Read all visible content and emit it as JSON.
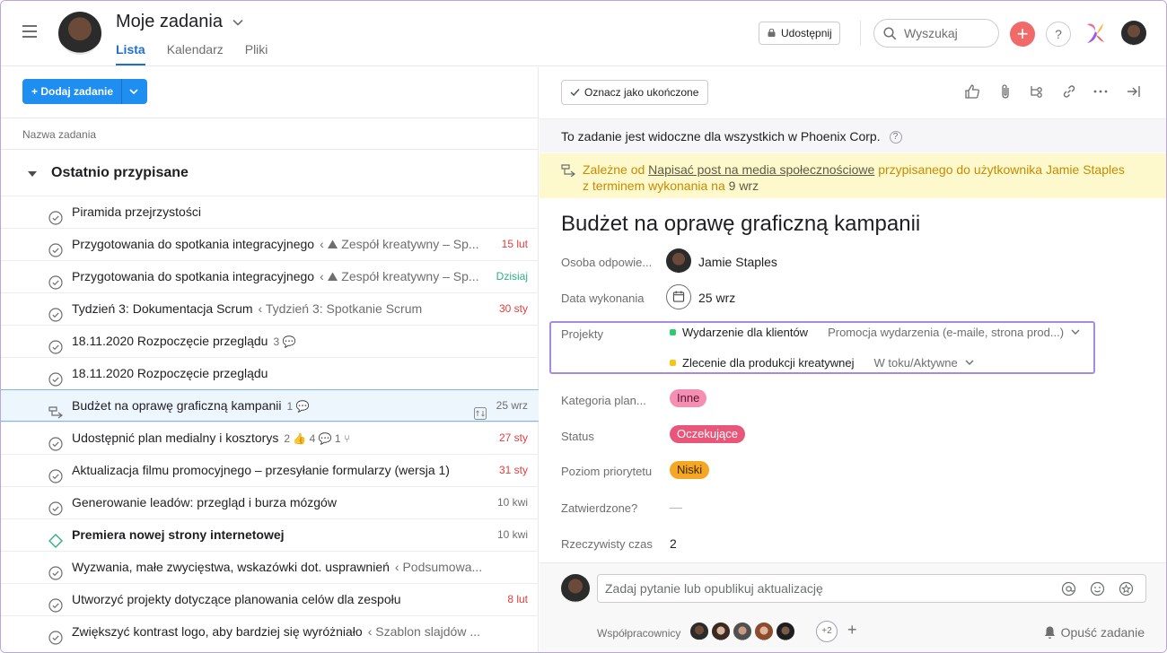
{
  "header": {
    "title": "Moje zadania",
    "tabs": [
      {
        "label": "Lista",
        "active": true
      },
      {
        "label": "Kalendarz",
        "active": false
      },
      {
        "label": "Pliki",
        "active": false
      }
    ],
    "share_label": "Udostępnij",
    "search_placeholder": "Wyszukaj",
    "help_label": "?"
  },
  "left": {
    "add_task_label": "+ Dodaj zadanie",
    "column_header": "Nazwa zadania",
    "section_title": "Ostatnio przypisane",
    "rows": [
      {
        "name": "Piramida przejrzystości",
        "project": "",
        "meta": "",
        "date": "",
        "date_color": ""
      },
      {
        "name": "Przygotowania do spotkania integracyjnego",
        "project": "‹ ⛰ Zespół kreatywny – Sp...",
        "meta": "",
        "date": "15 lut",
        "date_color": "red"
      },
      {
        "name": "Przygotowania do spotkania integracyjnego",
        "project": "‹ ⛰ Zespół kreatywny – Sp...",
        "meta": "",
        "date": "Dzisiaj",
        "date_color": "green"
      },
      {
        "name": "Tydzień 3: Dokumentacja Scrum",
        "project": "‹ Tydzień 3: Spotkanie Scrum",
        "meta": "",
        "date": "30 sty",
        "date_color": "red"
      },
      {
        "name": "18.11.2020 Rozpoczęcie przeglądu",
        "project": "",
        "meta": "3 💬",
        "date": "",
        "date_color": ""
      },
      {
        "name": "18.11.2020 Rozpoczęcie przeglądu",
        "project": "",
        "meta": "",
        "date": "",
        "date_color": ""
      },
      {
        "name": "Budżet na oprawę graficzną kampanii",
        "project": "",
        "meta": "1 💬",
        "date": "25 wrz",
        "date_color": ""
      },
      {
        "name": "Udostępnić plan medialny i kosztorys",
        "project": "",
        "meta": "2 👍  4 💬  1 ⑂",
        "date": "27 sty",
        "date_color": "red"
      },
      {
        "name": "Aktualizacja filmu promocyjnego – przesyłanie formularzy (wersja 1)",
        "project": "",
        "meta": "",
        "date": "31 sty",
        "date_color": "red"
      },
      {
        "name": "Generowanie leadów: przegląd i burza mózgów",
        "project": "",
        "meta": "",
        "date": "10 kwi",
        "date_color": ""
      },
      {
        "name": "Premiera nowej strony internetowej",
        "project": "",
        "meta": "",
        "date": "10 kwi",
        "date_color": ""
      },
      {
        "name": "Wyzwania, małe zwycięstwa, wskazówki dot. usprawnień",
        "project": "‹ Podsumowa...",
        "meta": "",
        "date": "",
        "date_color": ""
      },
      {
        "name": "Utworzyć projekty dotyczące planowania celów dla zespołu",
        "project": "",
        "meta": "",
        "date": "8 lut",
        "date_color": "red"
      },
      {
        "name": "Zwiększyć kontrast logo, aby bardziej się wyróżniało",
        "project": "‹ Szablon slajdów ...",
        "meta": "",
        "date": "",
        "date_color": ""
      }
    ]
  },
  "detail": {
    "mark_done_label": "Oznacz jako ukończone",
    "visibility_text": "To zadanie jest widoczne dla wszystkich w Phoenix Corp.",
    "dependency": {
      "prefix": "Zależne od ",
      "link": "Napisać post na media społecznościowe",
      "middle": " przypisanego do użytkownika Jamie Staples",
      "line2_prefix": "z terminem wykonania na ",
      "line2_date": "9 wrz"
    },
    "title": "Budżet na oprawę graficzną kampanii",
    "fields": {
      "assignee_label": "Osoba odpowie...",
      "assignee_value": "Jamie Staples",
      "due_label": "Data wykonania",
      "due_value": "25 wrz",
      "projects_label": "Projekty",
      "projects": [
        {
          "name": "Wydarzenie dla klientów",
          "section": "Promocja wydarzenia (e-maile, strona prod...)",
          "color": "#2ecc71"
        },
        {
          "name": "Zlecenie dla produkcji kreatywnej",
          "section": "W toku/Aktywne",
          "color": "#f5c518"
        }
      ],
      "category_label": "Kategoria plan...",
      "category_value": "Inne",
      "status_label": "Status",
      "status_value": "Oczekujące",
      "priority_label": "Poziom priorytetu",
      "priority_value": "Niski",
      "approved_label": "Zatwierdzone?",
      "approved_value": "—",
      "actual_time_label": "Rzeczywisty czas",
      "actual_time_value": "2"
    },
    "comment_placeholder": "Zadaj pytanie lub opublikuj aktualizację",
    "collaborators_label": "Współpracownicy",
    "collaborators_more": "+2",
    "collaborators_add": "+",
    "leave_label": "Opuść zadanie"
  },
  "colors": {
    "accent": "#1f8ef1",
    "tab_active": "#1e70cc",
    "overdue": "#e13e3e",
    "today": "#2fb180",
    "pill_category": "#f48fb1",
    "pill_status": "#e8577a",
    "pill_priority": "#f5a623"
  }
}
